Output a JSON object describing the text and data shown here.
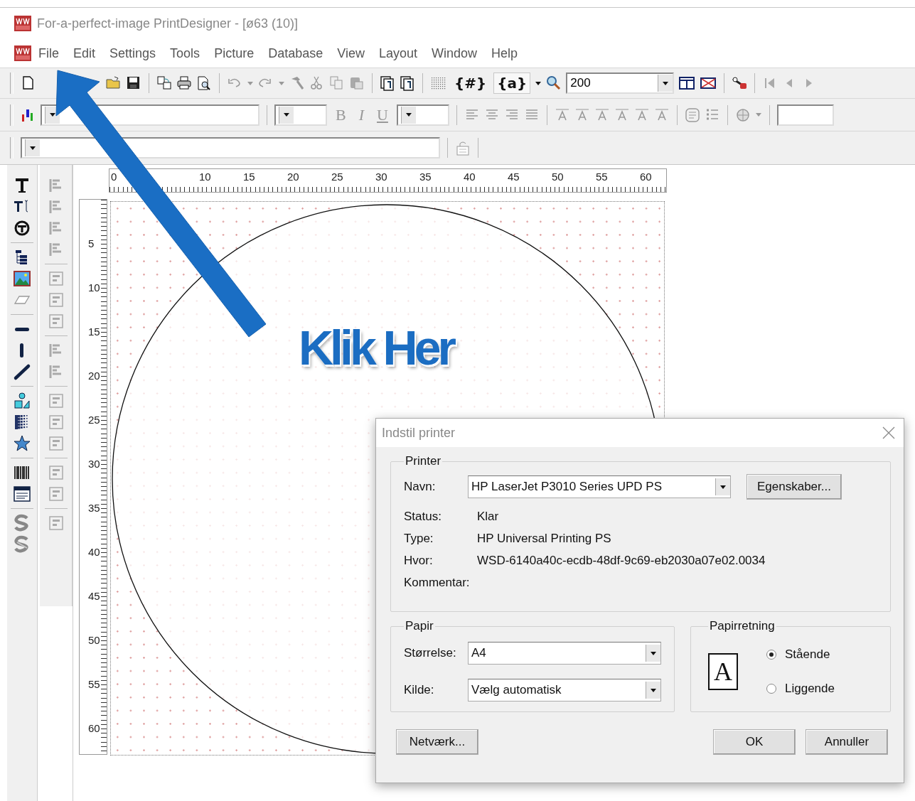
{
  "window": {
    "title": "For-a-perfect-image PrintDesigner - [ø63 (10)]"
  },
  "menu": [
    {
      "label": "File"
    },
    {
      "label": "Edit"
    },
    {
      "label": "Settings"
    },
    {
      "label": "Tools"
    },
    {
      "label": "Picture"
    },
    {
      "label": "Database"
    },
    {
      "label": "View"
    },
    {
      "label": "Layout"
    },
    {
      "label": "Window"
    },
    {
      "label": "Help"
    }
  ],
  "toolbar": {
    "field_button": "{#}",
    "variable_button": "{a}",
    "zoom_value": "200"
  },
  "format_bar": {
    "bold": "B",
    "italic": "I",
    "underline": "U"
  },
  "horizontal_ruler": {
    "labels": [
      "0",
      "10",
      "15",
      "20",
      "25",
      "30",
      "35",
      "40",
      "45",
      "50",
      "55",
      "60"
    ]
  },
  "vertical_ruler": {
    "labels": [
      "5",
      "10",
      "15",
      "20",
      "25",
      "30",
      "35",
      "40",
      "45",
      "50",
      "55",
      "60"
    ]
  },
  "annotation": {
    "text": "Klik Her"
  },
  "dialog": {
    "title": "Indstil printer",
    "printer": {
      "legend": "Printer",
      "name_label": "Navn:",
      "name_value": "HP LaserJet P3010 Series UPD PS",
      "properties_button": "Egenskaber...",
      "info": [
        {
          "label": "Status:",
          "value": "Klar"
        },
        {
          "label": "Type:",
          "value": "HP Universal Printing PS"
        },
        {
          "label": "Hvor:",
          "value": "WSD-6140a40c-ecdb-48df-9c69-eb2030a07e02.0034"
        },
        {
          "label": "Kommentar:"
        }
      ]
    },
    "paper": {
      "legend": "Papir",
      "fields": [
        {
          "label": "Størrelse:",
          "value": "A4"
        },
        {
          "label": "Kilde:",
          "value": "Vælg automatisk"
        }
      ]
    },
    "orientation": {
      "legend": "Papirretning",
      "preview_letter": "A",
      "options": [
        {
          "label": "Stående",
          "selected": true
        },
        {
          "label": "Liggende",
          "selected": false
        }
      ]
    },
    "buttons": [
      {
        "label": "Netværk...",
        "kind": "left"
      },
      {
        "label": "OK",
        "kind": "right"
      },
      {
        "label": "Annuller",
        "kind": "right"
      }
    ]
  }
}
